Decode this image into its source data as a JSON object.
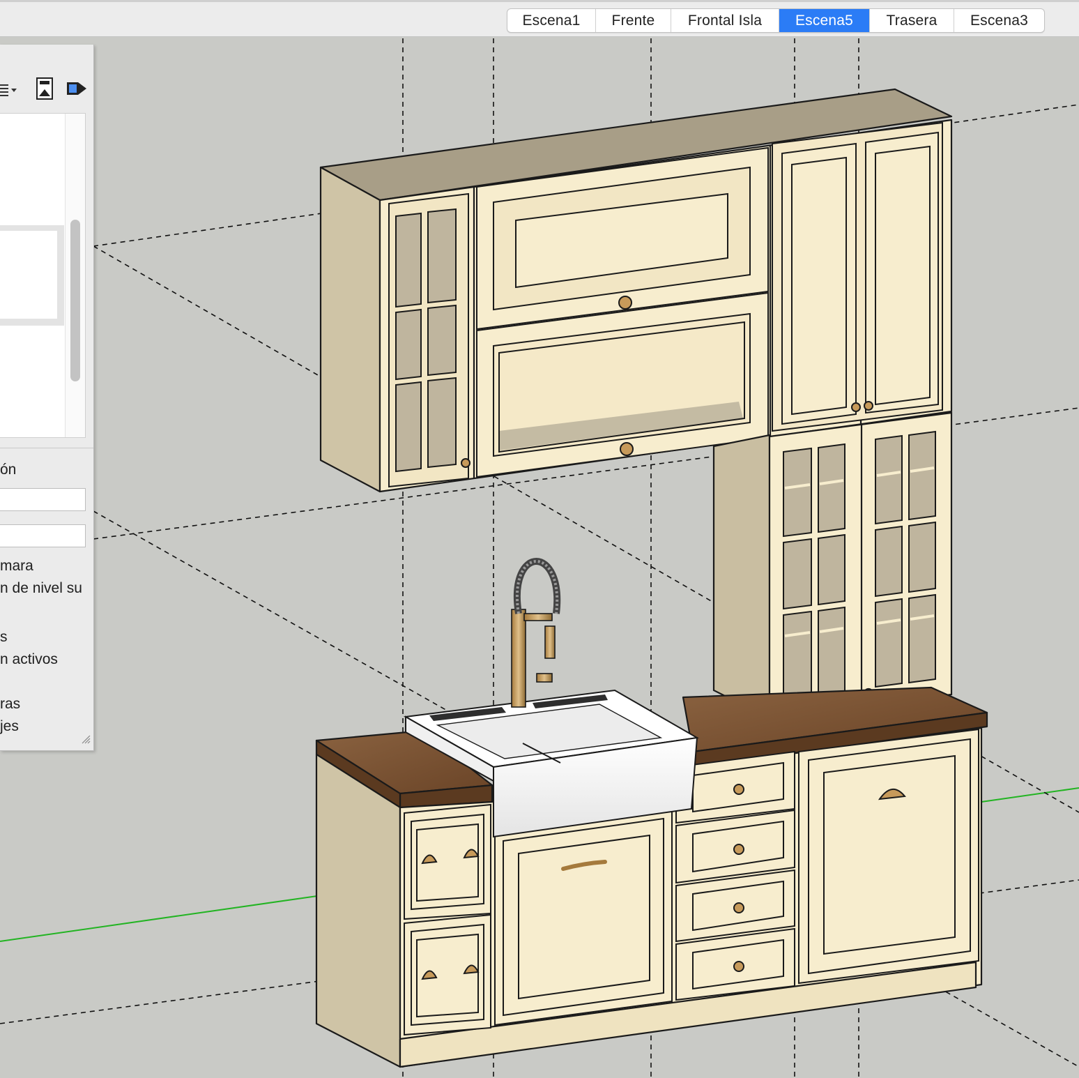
{
  "scene_tabs": [
    {
      "label": "Escena1",
      "active": false
    },
    {
      "label": "Frente",
      "active": false
    },
    {
      "label": "Frontal Isla",
      "active": false
    },
    {
      "label": "Escena5",
      "active": true
    },
    {
      "label": "Trasera",
      "active": false
    },
    {
      "label": "Escena3",
      "active": false
    }
  ],
  "panel": {
    "section_label": "ón",
    "options": [
      "mara",
      "n de nivel su",
      "s",
      "n activos",
      "ras",
      "jes"
    ]
  },
  "colors": {
    "active_tab": "#2b7cf6",
    "viewport_bg": "#c9cac6",
    "cabinet": "#f7edce",
    "countertop": "#7a5332",
    "green_axis": "#22b422"
  },
  "icons": [
    "list-view-dropdown-icon",
    "scene-update-icon",
    "export-arrow-icon"
  ]
}
